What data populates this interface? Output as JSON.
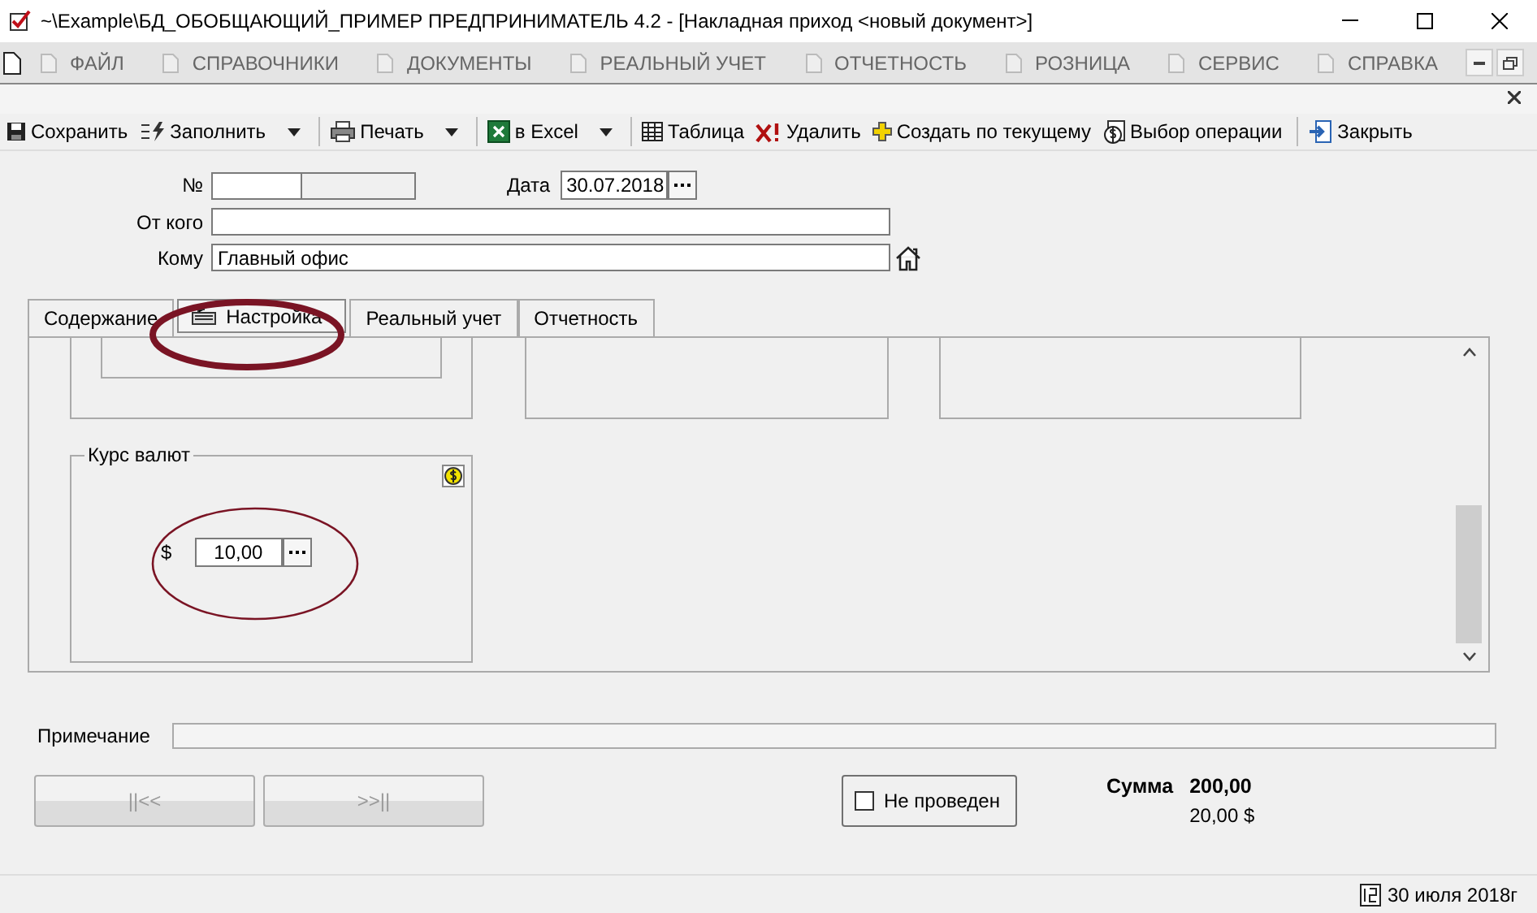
{
  "window": {
    "title": "~\\Example\\БД_ОБОБЩАЮЩИЙ_ПРИМЕР  ПРЕДПРИНИМАТЕЛЬ 4.2 - [Накладная приход <новый документ>]"
  },
  "menu": [
    {
      "label": "ФАЙЛ"
    },
    {
      "label": "СПРАВОЧНИКИ"
    },
    {
      "label": "ДОКУМЕНТЫ"
    },
    {
      "label": "РЕАЛЬНЫЙ УЧЕТ"
    },
    {
      "label": "ОТЧЕТНОСТЬ"
    },
    {
      "label": "РОЗНИЦА"
    },
    {
      "label": "СЕРВИС"
    },
    {
      "label": "СПРАВКА"
    }
  ],
  "toolbar": [
    {
      "label": "Сохранить",
      "dropdown": false
    },
    {
      "label": "Заполнить",
      "dropdown": true
    },
    {
      "label": "Печать",
      "dropdown": true
    },
    {
      "label": "в Excel",
      "dropdown": true
    },
    {
      "label": "Таблица",
      "dropdown": false
    },
    {
      "label": "Удалить",
      "dropdown": false
    },
    {
      "label": "Создать по текущему",
      "dropdown": false
    },
    {
      "label": "Выбор операции",
      "dropdown": false
    },
    {
      "label": "Закрыть",
      "dropdown": false
    }
  ],
  "form": {
    "number_label": "№",
    "date_label": "Дата",
    "date": "30.07.2018",
    "from_label": "От кого",
    "to_label": "Кому",
    "to": "Главный офис"
  },
  "tabs": [
    {
      "label": "Содержание",
      "selected": false
    },
    {
      "label": "Настройка",
      "selected": true
    },
    {
      "label": "Реальный учет",
      "selected": false
    },
    {
      "label": "Отчетность",
      "selected": false
    }
  ],
  "currency_group": {
    "title": "Курс валют",
    "symbol": "$",
    "rate": "10,00"
  },
  "note": {
    "label": "Примечание"
  },
  "nav_buttons": [
    {
      "label": "||<<",
      "disabled": true
    },
    {
      "label": ">>||",
      "disabled": true
    }
  ],
  "posted": {
    "label": "Не проведен",
    "checked": false
  },
  "sum": {
    "label": "Сумма",
    "value": "200,00",
    "currency_value": "20,00 $"
  },
  "status_bar": {
    "date": "30 июля 2018г"
  }
}
